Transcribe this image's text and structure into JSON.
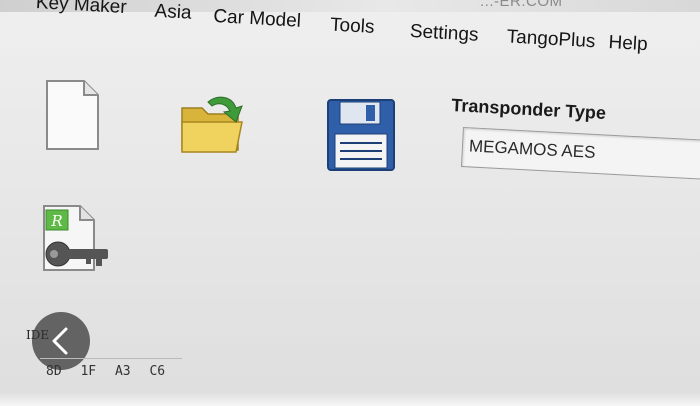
{
  "window": {
    "title_fragment": "...-ER.COM"
  },
  "menu": {
    "items": [
      "Key Maker",
      "Asia",
      "Car Model",
      "Tools",
      "Settings",
      "TangoPlus",
      "Help"
    ]
  },
  "toolbar": {
    "icons": [
      "new-file-icon",
      "open-folder-icon",
      "save-disk-icon",
      "key-file-icon"
    ],
    "key_file_badge": "R"
  },
  "transponder": {
    "label": "Transponder Type",
    "selected": "MEGAMOS AES"
  },
  "ide": {
    "label": "IDE",
    "bytes": [
      "8D",
      "1F",
      "A3",
      "C6"
    ]
  },
  "colors": {
    "folder": "#e7c64a",
    "folder_arrow": "#3f9a3a",
    "disk_blue": "#2f5fa8",
    "key_badge": "#5fb947"
  }
}
